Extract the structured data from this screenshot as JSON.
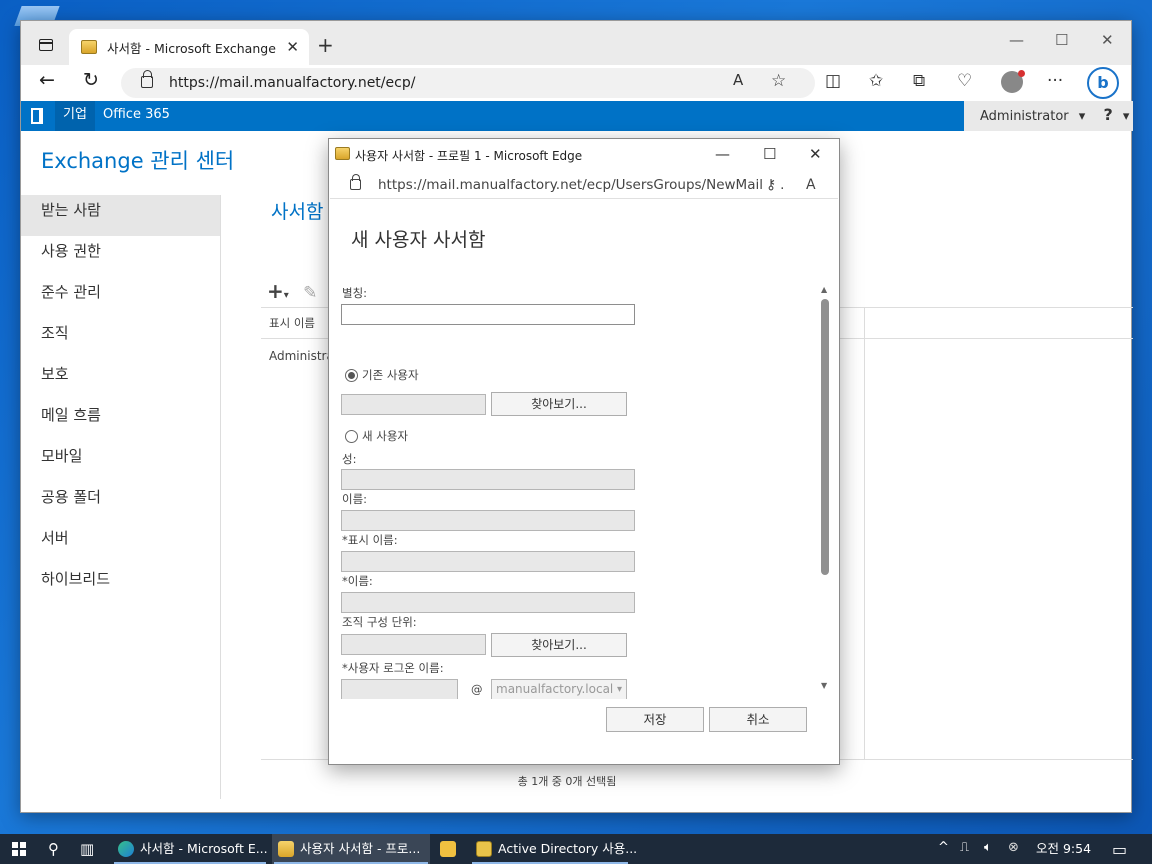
{
  "browser": {
    "tab_title": "사서함 - Microsoft Exchange",
    "tab_close": "✕",
    "new_tab": "+",
    "url": "https://mail.manualfactory.net/ecp/",
    "read_aloud_label": "A",
    "window_controls": {
      "minimize": "—",
      "maximize": "☐",
      "close": "✕"
    },
    "toolbar_icons": [
      "read-aloud-icon",
      "favorite-icon",
      "split-screen-icon",
      "favorites-icon",
      "collections-icon",
      "browser-essentials-icon",
      "profile-icon",
      "more-icon",
      "bing-icon"
    ],
    "more_label": "···",
    "bing_label": "b"
  },
  "o365": {
    "enterprise": "기업",
    "office": "Office 365",
    "admin": "Administrator",
    "admin_caret": "▾",
    "help": "?",
    "help_caret": "▾"
  },
  "ecp": {
    "title": "Exchange 관리 센터",
    "nav": [
      "받는 사람",
      "사용 권한",
      "준수 관리",
      "조직",
      "보호",
      "메일 흐름",
      "모바일",
      "공용 폴더",
      "서버",
      "하이브리드"
    ],
    "active_nav": 0,
    "section_title": "사서함",
    "toolbar": {
      "add": "+",
      "add_caret": "▾",
      "edit": "✎"
    },
    "grid_header": "표시 이름",
    "grid_row": "Administra",
    "status": "총 1개 중 0개 선택됨"
  },
  "popup": {
    "title": "사용자 사서함 - 프로필 1 - Microsoft Edge",
    "url": "https://mail.manualfactory.net/ecp/UsersGroups/NewMailb...",
    "read_aloud_label": "A",
    "key_icon_label": "⚷",
    "heading": "새 사용자 사서함",
    "alias_label": "별칭:",
    "existing_user_label": "기존 사용자",
    "browse_label": "찾아보기...",
    "new_user_label": "새 사용자",
    "last_name_label": "성:",
    "first_name_label": "이름:",
    "display_name_label": "*표시 이름:",
    "name_label": "*이름:",
    "ou_label": "조직 구성 단위:",
    "browse_label_2": "찾아보기...",
    "logon_label": "*사용자 로그온 이름:",
    "at_sign": "@",
    "domain_value": "manualfactory.local",
    "domain_caret": "▾",
    "scroll_up": "▲",
    "scroll_down": "▼",
    "save_label": "저장",
    "cancel_label": "취소",
    "window_controls": {
      "minimize": "—",
      "maximize": "☐",
      "close": "✕"
    }
  },
  "taskbar": {
    "apps": [
      "사서함 - Microsoft E...",
      "사용자 사서함 - 프로...",
      "",
      "Active Directory 사용..."
    ],
    "tray_caret": "^",
    "clock": "오전 9:54"
  }
}
